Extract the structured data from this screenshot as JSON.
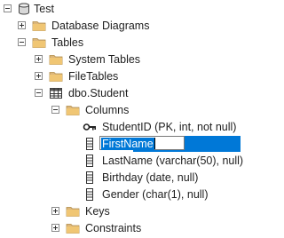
{
  "tree": {
    "nodes": [
      {
        "id": "test",
        "label": "Test",
        "icon": "database-icon",
        "expander": "minus"
      },
      {
        "id": "database-diagrams",
        "label": "Database Diagrams",
        "icon": "folder-icon",
        "expander": "plus"
      },
      {
        "id": "tables",
        "label": "Tables",
        "icon": "folder-icon",
        "expander": "minus"
      },
      {
        "id": "system-tables",
        "label": "System Tables",
        "icon": "folder-icon",
        "expander": "plus"
      },
      {
        "id": "filetables",
        "label": "FileTables",
        "icon": "folder-icon",
        "expander": "plus"
      },
      {
        "id": "dbo-student",
        "label": "dbo.Student",
        "icon": "table-icon",
        "expander": "minus"
      },
      {
        "id": "columns",
        "label": "Columns",
        "icon": "folder-icon",
        "expander": "minus"
      },
      {
        "id": "studentid",
        "label": "StudentID (PK, int, not null)",
        "icon": "primary-key-icon",
        "expander": "none"
      },
      {
        "id": "firstname",
        "label": "FirstName",
        "icon": "column-icon",
        "expander": "none",
        "editing": true
      },
      {
        "id": "lastname",
        "label": "LastName (varchar(50), null)",
        "icon": "column-icon",
        "expander": "none"
      },
      {
        "id": "birthday",
        "label": "Birthday (date, null)",
        "icon": "column-icon",
        "expander": "none"
      },
      {
        "id": "gender",
        "label": "Gender (char(1), null)",
        "icon": "column-icon",
        "expander": "none"
      },
      {
        "id": "keys",
        "label": "Keys",
        "icon": "folder-icon",
        "expander": "plus"
      },
      {
        "id": "constraints",
        "label": "Constraints",
        "icon": "folder-icon",
        "expander": "plus"
      }
    ],
    "edit_value": "FirstName"
  }
}
